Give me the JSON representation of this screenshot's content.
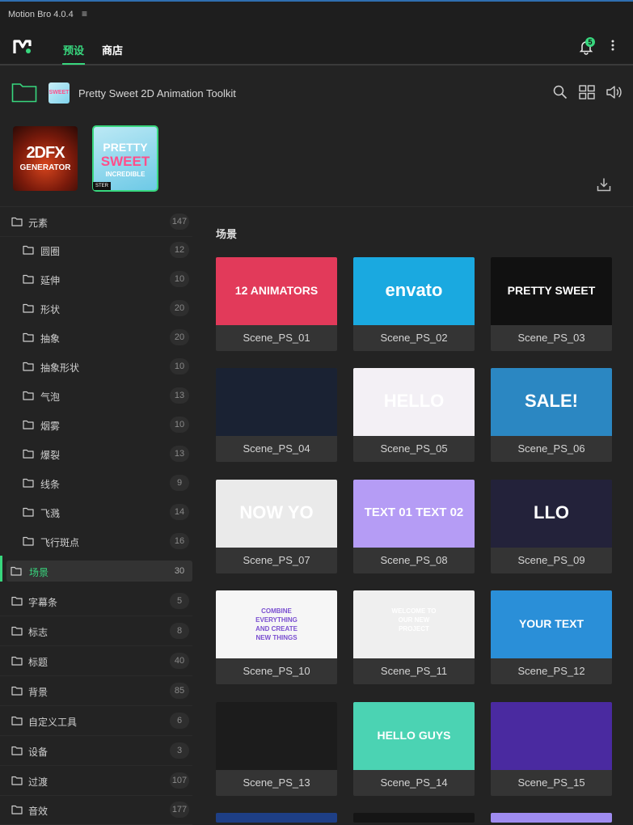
{
  "app": {
    "title": "Motion Bro 4.0.4",
    "menu_glyph": "≡"
  },
  "nav": {
    "tabs": [
      {
        "label": "预设",
        "active": true
      },
      {
        "label": "商店",
        "active": false
      }
    ],
    "notifications_count": "5",
    "accent_color": "#38d77e"
  },
  "pack": {
    "title": "Pretty Sweet 2D Animation Toolkit",
    "small_thumb_text": "SWEET",
    "packs": [
      {
        "line1": "2DFX",
        "line2": "GENERATOR"
      },
      {
        "line1": "PRETTY",
        "line2": "SWEET",
        "line3": "INCREDIBLE",
        "tag": "STER"
      }
    ]
  },
  "sidebar": {
    "items": [
      {
        "label": "元素",
        "count": "147",
        "level": 0
      },
      {
        "label": "圆圈",
        "count": "12",
        "level": 1
      },
      {
        "label": "延伸",
        "count": "10",
        "level": 1
      },
      {
        "label": "形状",
        "count": "20",
        "level": 1
      },
      {
        "label": "抽象",
        "count": "20",
        "level": 1
      },
      {
        "label": "抽象形状",
        "count": "10",
        "level": 1
      },
      {
        "label": "气泡",
        "count": "13",
        "level": 1
      },
      {
        "label": "烟雾",
        "count": "10",
        "level": 1
      },
      {
        "label": "爆裂",
        "count": "13",
        "level": 1
      },
      {
        "label": "线条",
        "count": "9",
        "level": 1
      },
      {
        "label": "飞溅",
        "count": "14",
        "level": 1
      },
      {
        "label": "飞行斑点",
        "count": "16",
        "level": 1
      },
      {
        "label": "场景",
        "count": "30",
        "level": 0,
        "active": true
      },
      {
        "label": "字幕条",
        "count": "5",
        "level": 0
      },
      {
        "label": "标志",
        "count": "8",
        "level": 0
      },
      {
        "label": "标题",
        "count": "40",
        "level": 0
      },
      {
        "label": "背景",
        "count": "85",
        "level": 0
      },
      {
        "label": "自定义工具",
        "count": "6",
        "level": 0
      },
      {
        "label": "设备",
        "count": "3",
        "level": 0
      },
      {
        "label": "过渡",
        "count": "107",
        "level": 0
      },
      {
        "label": "音效",
        "count": "177",
        "level": 0
      }
    ]
  },
  "main": {
    "section_title": "场景",
    "scenes": [
      {
        "name": "Scene_PS_01",
        "text": "12 ANIMATORS",
        "bg": "#e23a5a",
        "fg": "#ffffff"
      },
      {
        "name": "Scene_PS_02",
        "text": "envato",
        "bg": "#1aa9e0",
        "fg": "#ffffff"
      },
      {
        "name": "Scene_PS_03",
        "text": "PRETTY SWEET",
        "bg": "#111111",
        "fg": "#ffffff"
      },
      {
        "name": "Scene_PS_04",
        "text": "",
        "bg": "#1a2233",
        "fg": "#ffffff"
      },
      {
        "name": "Scene_PS_05",
        "text": "HELLO",
        "bg": "#f3f0f5",
        "fg": "#ffffff"
      },
      {
        "name": "Scene_PS_06",
        "text": "SALE!",
        "bg": "#2b87c2",
        "fg": "#ffffff"
      },
      {
        "name": "Scene_PS_07",
        "text": "NOW YO",
        "bg": "#eaeaea",
        "fg": "#ffffff"
      },
      {
        "name": "Scene_PS_08",
        "text": "TEXT 01 TEXT 02",
        "bg": "#b59cf5",
        "fg": "#ffffff"
      },
      {
        "name": "Scene_PS_09",
        "text": "LLO",
        "bg": "#23223a",
        "fg": "#ffffff"
      },
      {
        "name": "Scene_PS_10",
        "text": "COMBINE EVERYTHING AND CREATE NEW THINGS",
        "bg": "#f6f6f6",
        "fg": "#7a4fd0"
      },
      {
        "name": "Scene_PS_11",
        "text": "WELCOME TO OUR NEW PROJECT",
        "bg": "#efefef",
        "fg": "#ffffff"
      },
      {
        "name": "Scene_PS_12",
        "text": "YOUR TEXT",
        "bg": "#2a8fd8",
        "fg": "#ffffff"
      },
      {
        "name": "Scene_PS_13",
        "text": "",
        "bg": "#1c1c1c",
        "fg": "#ffffff"
      },
      {
        "name": "Scene_PS_14",
        "text": "HELLO GUYS",
        "bg": "#4bd3b3",
        "fg": "#ffffff"
      },
      {
        "name": "Scene_PS_15",
        "text": "",
        "bg": "#4a2aa0",
        "fg": "#ffffff"
      }
    ]
  }
}
